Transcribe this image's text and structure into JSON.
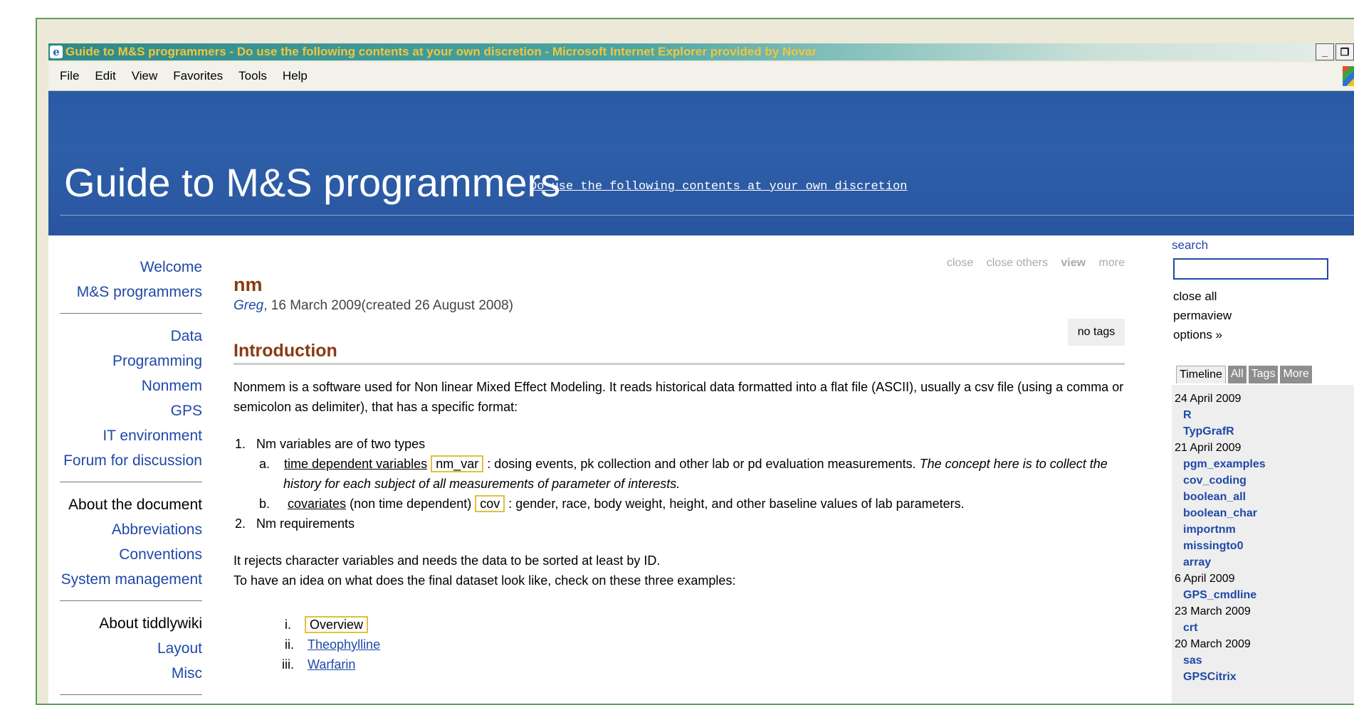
{
  "window": {
    "title": "Guide to M&S programmers - Do use the following contents at your own discretion - Microsoft Internet Explorer provided by Novar",
    "controls": [
      "_",
      "8"
    ]
  },
  "menubar": [
    "File",
    "Edit",
    "View",
    "Favorites",
    "Tools",
    "Help"
  ],
  "header": {
    "title": "Guide to M&S programmers",
    "subtitle": "Do use the following contents at your own discretion"
  },
  "mainmenu": {
    "group1": [
      "Welcome",
      "M&S programmers"
    ],
    "group2": [
      "Data",
      "Programming",
      "Nonmem",
      "GPS",
      "IT environment",
      "Forum for discussion"
    ],
    "group3_heading": "About the document",
    "group3": [
      "Abbreviations",
      "Conventions",
      "System management"
    ],
    "group4_heading": "About tiddlywiki",
    "group4": [
      "Layout",
      "Misc"
    ]
  },
  "tiddler": {
    "commands": [
      "close",
      "close others",
      "view",
      "more"
    ],
    "title": "nm",
    "author": "Greg",
    "dates": ", 16 March 2009(created 26 August 2008)",
    "no_tags": "no tags",
    "heading": "Introduction",
    "intro": "Nonmem is a software used for Non linear Mixed Effect Modeling. It reads historical data formatted into a flat file (ASCII), usually a csv file (using a comma or",
    "intro2": "semicolon as delimiter), that has a specific format:",
    "li1": "1.   Nm variables are of two types",
    "li1a_marker": "a.",
    "li1a_link": "time dependent variables",
    "li1a_code": "nm_var",
    "li1a_text": ": dosing events, pk collection and other lab or pd evaluation measurements.",
    "li1a_italic": "The concept here is to collect the",
    "li1a_italic2": "history for each subject of all measurements of parameter of interests.",
    "li1b_marker": "b.",
    "li1b_link": "covariates",
    "li1b_text1": "(non time dependent)",
    "li1b_code": "cov",
    "li1b_text2": ": gender, race, body weight, height, and other baseline values of lab parameters.",
    "li2": "2.   Nm requirements",
    "p1": "It rejects character variables and needs the data to be sorted at least by ID.",
    "p2": "To have an idea on what does the final dataset look like, check on these three examples:",
    "examples": [
      {
        "marker": "i.",
        "label": "Overview"
      },
      {
        "marker": "ii.",
        "label": "Theophylline"
      },
      {
        "marker": "iii.",
        "label": "Warfarin"
      }
    ]
  },
  "sidebar": {
    "search_label": "search",
    "search_value": "",
    "options": [
      "close all",
      "permaview",
      "options »"
    ],
    "tabs": [
      "Timeline",
      "All",
      "Tags",
      "More"
    ],
    "timeline": [
      {
        "date": "24 April 2009",
        "items": [
          "R",
          "TypGrafR"
        ]
      },
      {
        "date": "21 April 2009",
        "items": [
          "pgm_examples",
          "cov_coding",
          "boolean_all",
          "boolean_char",
          "importnm",
          "missingto0",
          "array"
        ]
      },
      {
        "date": "6 April 2009",
        "items": [
          "GPS_cmdline"
        ]
      },
      {
        "date": "23 March 2009",
        "items": [
          "crt"
        ]
      },
      {
        "date": "20 March 2009",
        "items": [
          "sas",
          "GPSCitrix"
        ]
      }
    ]
  }
}
